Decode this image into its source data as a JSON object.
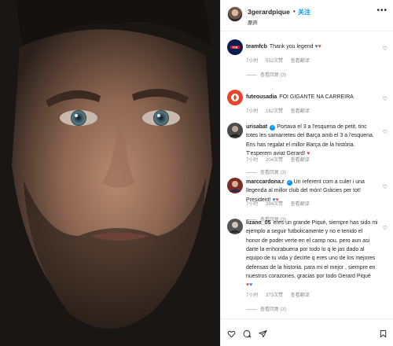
{
  "post": {
    "username": "3gerardpique",
    "separator": "•",
    "follow_label": "关注",
    "subtitle": "原声",
    "more_label": "•••"
  },
  "comments": [
    {
      "username": "teamfcb",
      "verified": false,
      "text": "Thank you legend",
      "emoji": [
        "♥",
        "♥"
      ],
      "time": "7小时",
      "likes": "552次赞",
      "translate": "查看翻译",
      "replies": "查看回复 (3)",
      "avatar_color": "#0b1d4e"
    },
    {
      "username": "futeousadia",
      "verified": false,
      "text": "FOI GIGANTE NA CARREIRA",
      "emoji": [],
      "time": "7小时",
      "likes": "182次赞",
      "translate": "查看翻译",
      "replies": "",
      "avatar_color": "#e8452f"
    },
    {
      "username": "urisabat",
      "verified": true,
      "text": "Portava el 3 a l'esquena de petit, tinc totes les samarretes del Barça amb el 3 a l'esquena. Ens has regalat el millor Barça de la història. T'esperem aviat Gerard!",
      "emoji": [
        "♥"
      ],
      "time": "7小时",
      "likes": "204次赞",
      "translate": "查看翻译",
      "replies": "查看回复 (3)",
      "avatar_color": "#444444"
    },
    {
      "username": "marccardona.r",
      "verified": true,
      "text": "Un referent com a culer i una llegenda al millor club del món! Gràcies per tot! President!",
      "emoji": [
        "♥",
        "♥"
      ],
      "time": "7小时",
      "likes": "394次赞",
      "translate": "查看翻译",
      "replies": "查看回复 (3)",
      "avatar_color": "#a0402e"
    },
    {
      "username": "lizann_05",
      "verified": false,
      "text": "eres un grande Piqué, siempre has sido mi ejemplo a seguir futbolicamente y no e tenido el honor de poder verte en el camp nou. pero aun asi darte la enhorabuena por todo lo q le jas dado al equipo de tu vida y decirte q eres uno de los mejores defensas de la historia. para mi el mejor , siempre en nuestros corazones, gracias por todo Gerard Piqué",
      "emoji": [
        "♥",
        "♥"
      ],
      "time": "7小时",
      "likes": "373次赞",
      "translate": "查看翻译",
      "replies": "查看回复 (3)",
      "avatar_color": "#555555"
    }
  ],
  "actions": [
    "heart-icon",
    "comment-icon",
    "share-icon",
    "save-icon"
  ]
}
